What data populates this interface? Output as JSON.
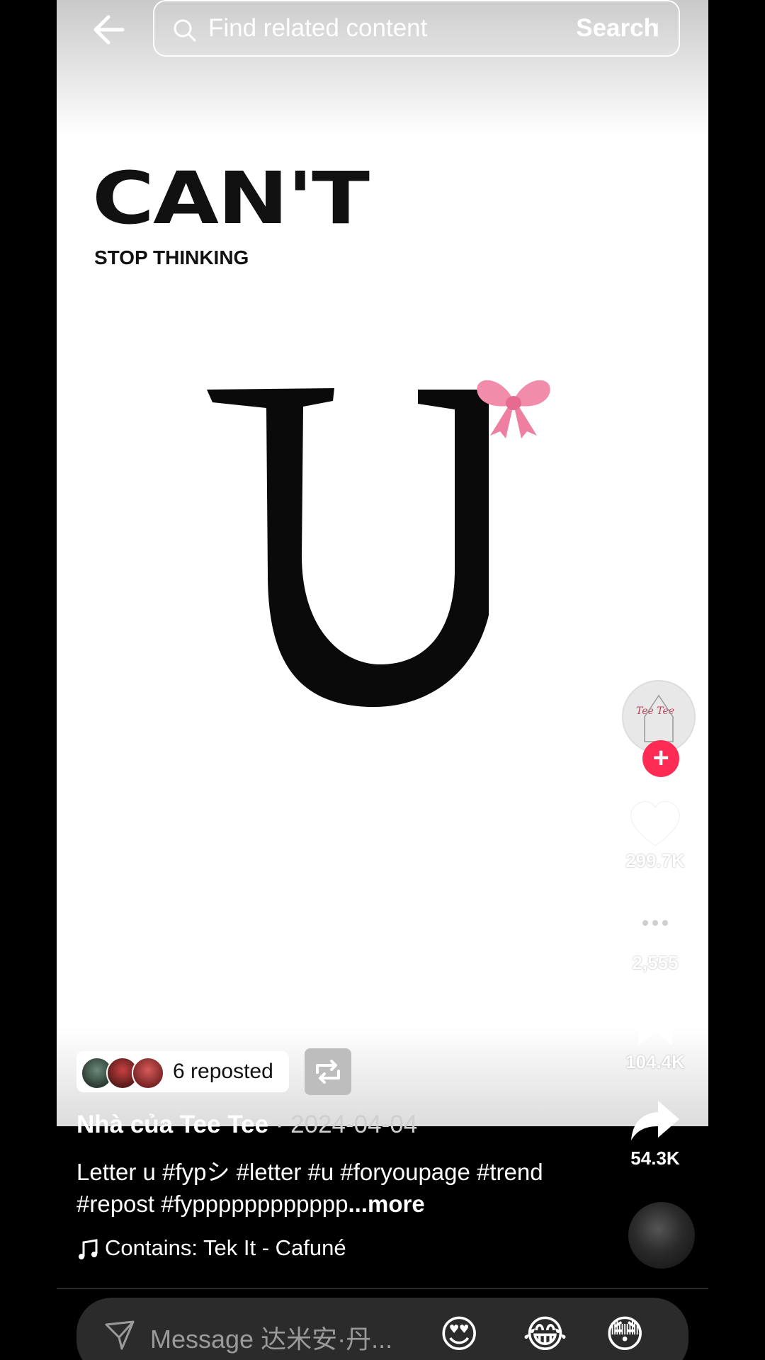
{
  "header": {
    "search_placeholder": "Find related content",
    "search_button": "Search"
  },
  "video": {
    "headline": "CAN'T",
    "subline": "STOP THINKING",
    "bow_emoji": "🎀"
  },
  "creator": {
    "avatar_text": "Tee Tee",
    "follow_symbol": "+"
  },
  "actions": {
    "likes": "299.7K",
    "comments": "2,555",
    "saves": "104.4K",
    "shares": "54.3K"
  },
  "repost": {
    "label": "6 reposted"
  },
  "post": {
    "username": "Nhà của Tee Tee",
    "date": " · 2024-04-04",
    "caption": "Letter u #fypシ #letter #u #foryoupage #trend #repost #fypppppppppppp",
    "more": "...more",
    "music": "Contains: Tek It - Cafuné"
  },
  "message_bar": {
    "placeholder": "Message 达米安·丹...",
    "emojis": [
      "😍",
      "😂",
      "😳"
    ]
  },
  "colors": {
    "follow_accent": "#fe2c55",
    "background": "#000000"
  }
}
